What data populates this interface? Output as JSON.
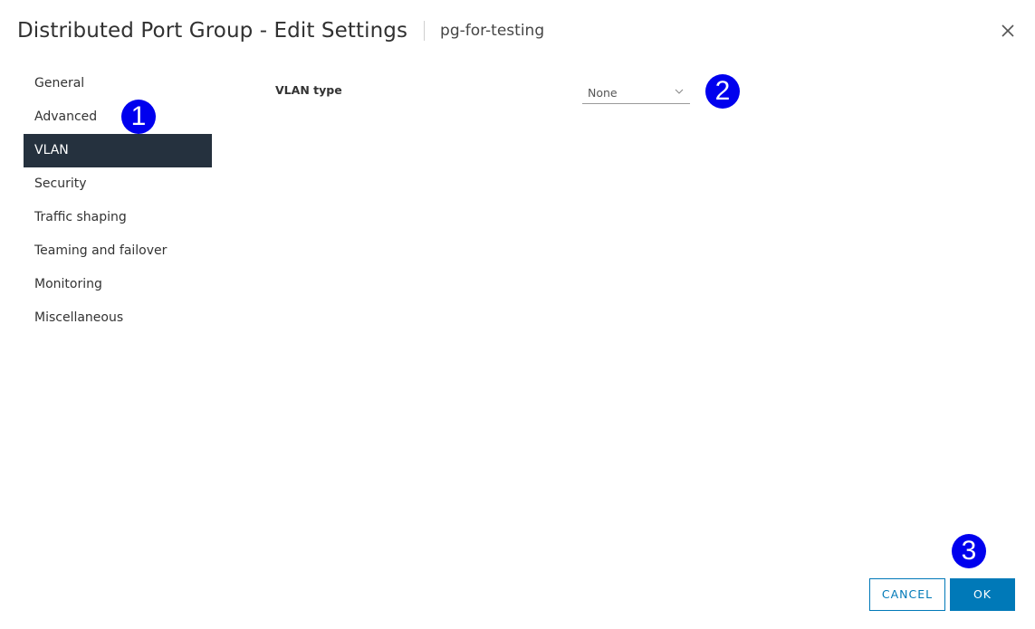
{
  "dialog": {
    "title": "Distributed Port Group - Edit Settings",
    "subtitle": "pg-for-testing",
    "close_icon": "close-icon"
  },
  "sidebar": {
    "items": [
      {
        "label": "General",
        "active": false
      },
      {
        "label": "Advanced",
        "active": false
      },
      {
        "label": "VLAN",
        "active": true
      },
      {
        "label": "Security",
        "active": false
      },
      {
        "label": "Traffic shaping",
        "active": false
      },
      {
        "label": "Teaming and failover",
        "active": false
      },
      {
        "label": "Monitoring",
        "active": false
      },
      {
        "label": "Miscellaneous",
        "active": false
      }
    ]
  },
  "main": {
    "vlan_type_label": "VLAN type",
    "vlan_type_value": "None",
    "vlan_type_icon": "chevron-down-icon"
  },
  "annotations": {
    "marker_1": "1",
    "marker_2": "2",
    "marker_3": "3",
    "marker_color": "#0000ee"
  },
  "footer": {
    "cancel_label": "CANCEL",
    "ok_label": "OK"
  },
  "colors": {
    "active_nav_bg": "#25313e",
    "primary": "#0079b8"
  }
}
